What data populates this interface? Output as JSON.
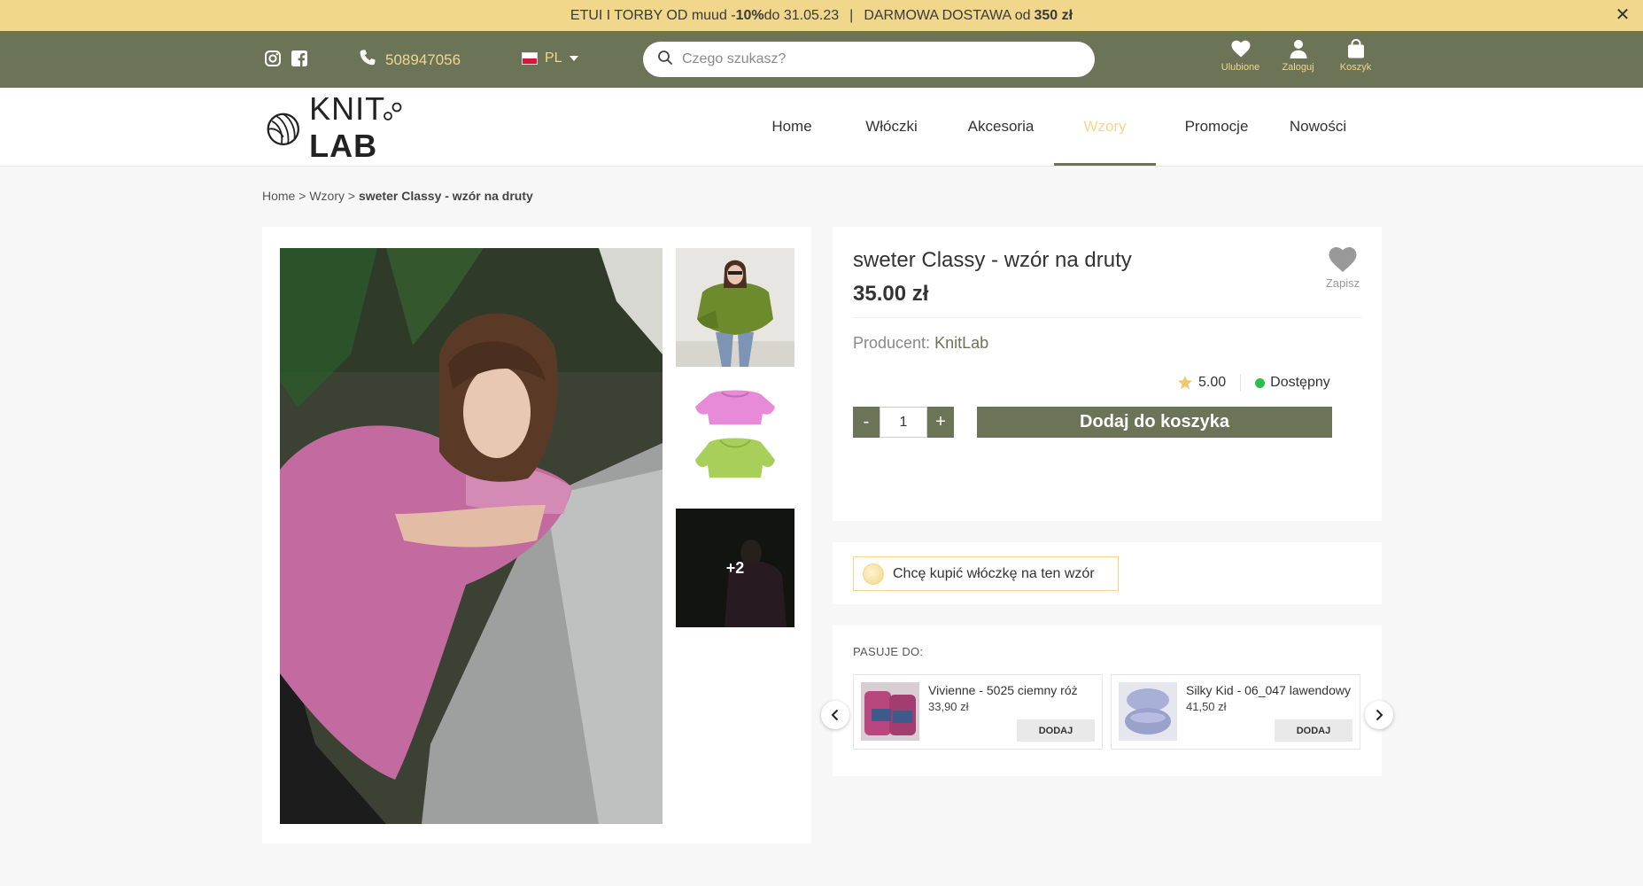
{
  "promo": {
    "part1": "ETUI I TORBY OD muud - ",
    "discount": "10%",
    "part2": " do 31.05.23",
    "separator": "|",
    "part3": "DARMOWA DOSTAWA od ",
    "threshold": "350 zł",
    "close_label": "✕"
  },
  "topbar": {
    "phone": "508947056",
    "language": "PL",
    "search_placeholder": "Czego szukasz?",
    "icons": [
      {
        "label": "Ulubione",
        "icon": "heart-icon"
      },
      {
        "label": "Zaloguj",
        "icon": "user-icon"
      },
      {
        "label": "Koszyk",
        "icon": "bag-icon"
      }
    ]
  },
  "header": {
    "logo": {
      "text_light": "KNIT ",
      "text_bold": "LAB"
    },
    "nav": [
      {
        "label": "Home",
        "active": false
      },
      {
        "label": "Włóczki",
        "active": false
      },
      {
        "label": "Akcesoria",
        "active": false
      },
      {
        "label": "Wzory",
        "active": true
      },
      {
        "label": "Promocje",
        "active": false
      },
      {
        "label": "Nowości",
        "active": false
      }
    ]
  },
  "breadcrumb": {
    "items": [
      "Home",
      "Wzory"
    ],
    "separator": ">",
    "current": "sweter Classy - wzór na druty"
  },
  "gallery": {
    "more_count": "+2"
  },
  "product": {
    "title": "sweter Classy - wzór na druty",
    "price": "35.00 zł",
    "save_label": "Zapisz",
    "producer_label": "Producent:",
    "producer": "KnitLab",
    "rating": "5.00",
    "availability": "Dostępny",
    "quantity": "1",
    "minus_label": "-",
    "plus_label": "+",
    "add_to_cart": "Dodaj do koszyka"
  },
  "buy_yarn": {
    "label": "Chcę kupić włóczkę na ten wzór"
  },
  "fits": {
    "title": "PASUJE DO:",
    "items": [
      {
        "name": "Vivienne - 5025 ciemny róż",
        "price": "33,90 zł",
        "button": "DODAJ",
        "color": "#b8467f"
      },
      {
        "name": "Silky Kid - 06_047 lawendowy",
        "price": "41,50 zł",
        "button": "DODAJ",
        "color": "#a8b0d8"
      }
    ]
  },
  "colors": {
    "olive": "#6b7456",
    "gold": "#f0d78c",
    "available": "#2fbd4a"
  }
}
